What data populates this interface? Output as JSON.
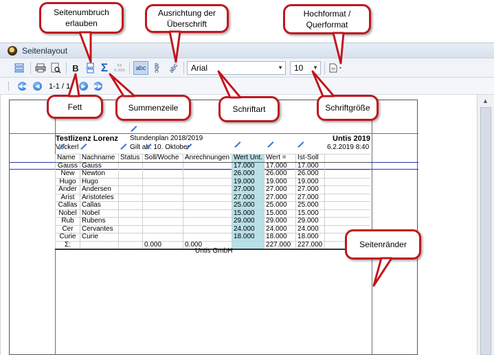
{
  "window": {
    "title": "Seitenlayout"
  },
  "toolbar": {
    "bold_label": "B",
    "abc_normal": "abc",
    "abc_vertical": "abc",
    "abc_diagonal": "abc",
    "font_name": "Arial",
    "font_size": "10"
  },
  "navigation": {
    "page_info": "1-1 / 1"
  },
  "report": {
    "license": "Testlizenz Lorenz",
    "location": "Vöckerl",
    "plan_title": "Stundenplan 2018/2019",
    "valid_from": "Gilt ab: 10. Oktober",
    "product": "Untis 2019",
    "date_time": "6.2.2019  8:40",
    "columns": [
      "Name",
      "Nachname",
      "Status",
      "Soll/Woche",
      "Anrechnungen",
      "Wert Unt.",
      "Wert =",
      "Ist-Soll"
    ],
    "rows": [
      [
        "Gauss",
        "Gauss",
        "",
        "",
        "",
        "17.000",
        "17.000",
        "17.000"
      ],
      [
        "New",
        "Newton",
        "",
        "",
        "",
        "26.000",
        "26.000",
        "26.000"
      ],
      [
        "Hugo",
        "Hugo",
        "",
        "",
        "",
        "19.000",
        "19.000",
        "19.000"
      ],
      [
        "Ander",
        "Andersen",
        "",
        "",
        "",
        "27.000",
        "27.000",
        "27.000"
      ],
      [
        "Arist",
        "Aristoteles",
        "",
        "",
        "",
        "27.000",
        "27.000",
        "27.000"
      ],
      [
        "Callas",
        "Callas",
        "",
        "",
        "",
        "25.000",
        "25.000",
        "25.000"
      ],
      [
        "Nobel",
        "Nobel",
        "",
        "",
        "",
        "15.000",
        "15.000",
        "15.000"
      ],
      [
        "Rub",
        "Rubens",
        "",
        "",
        "",
        "29.000",
        "29.000",
        "29.000"
      ],
      [
        "Cer",
        "Cervantes",
        "",
        "",
        "",
        "24.000",
        "24.000",
        "24.000"
      ],
      [
        "Curie",
        "Curie",
        "",
        "",
        "",
        "18.000",
        "18.000",
        "18.000"
      ]
    ],
    "sum_row": [
      "Σ:",
      "",
      "",
      "0.000",
      "0.000",
      "",
      "227.000",
      "227.000"
    ],
    "footer": "Untis GmbH"
  },
  "callouts": {
    "page_break": "Seitenumbruch erlauben",
    "heading_alignment": "Ausrichtung der Überschrift",
    "orientation": "Hochformat / Querformat",
    "bold": "Fett",
    "sum_row": "Summenzeile",
    "font": "Schriftart",
    "font_size": "Schriftgröße",
    "margins": "Seitenränder"
  },
  "colors": {
    "callout_border": "#c0171d",
    "highlight_column": "#b7e1e8",
    "margin_guides": "#2233aa"
  }
}
